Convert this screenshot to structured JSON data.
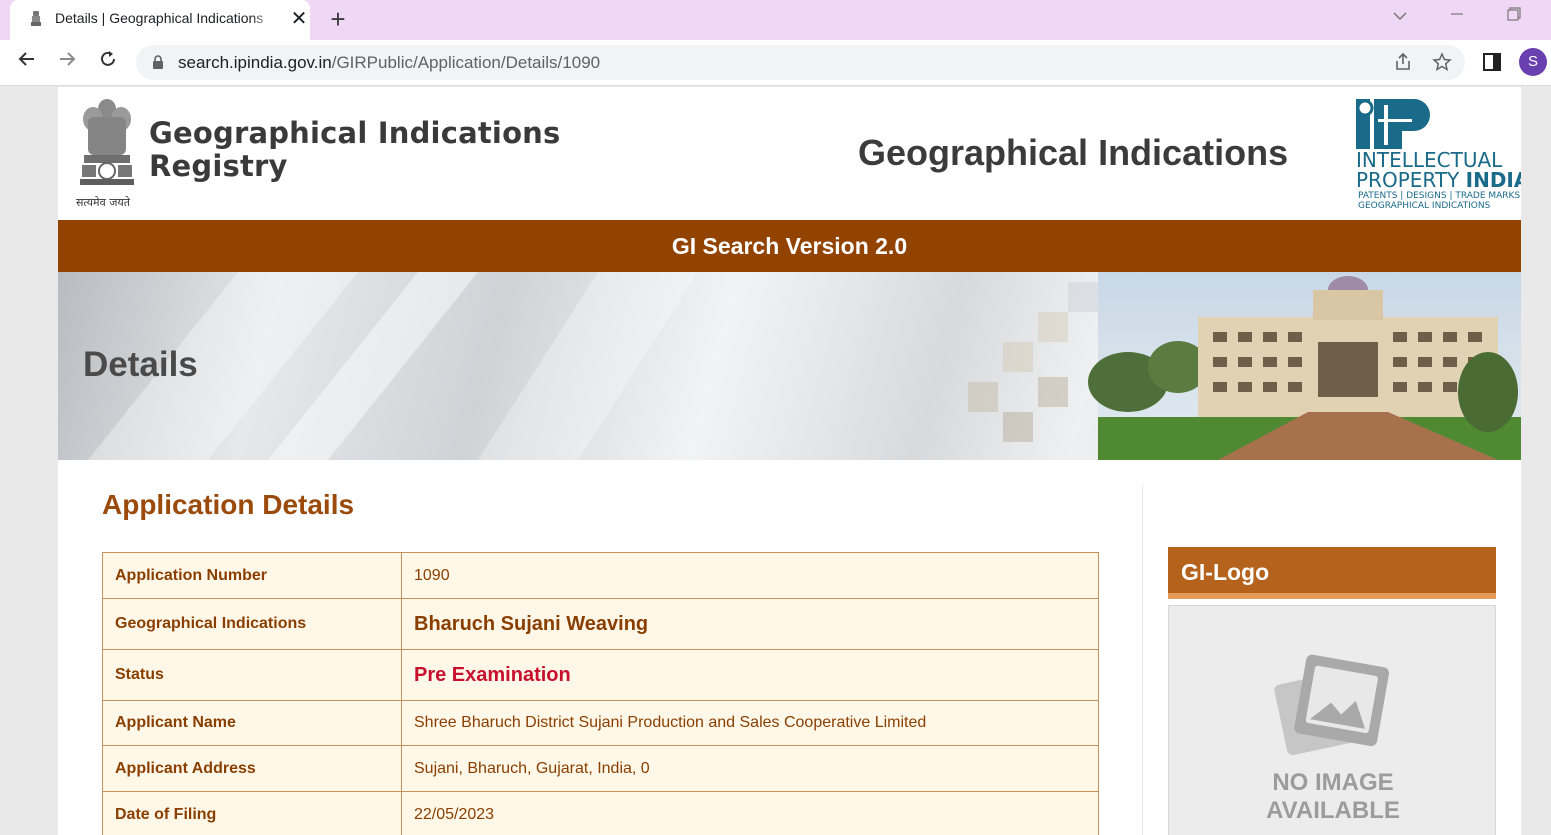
{
  "browser": {
    "tab_title": "Details | Geographical Indications",
    "new_tab_glyph": "+",
    "url_host": "search.ipindia.gov.in",
    "url_path": "/GIRPublic/Application/Details/1090",
    "profile_initial": "S"
  },
  "header": {
    "registry_line1": "Geographical Indications",
    "registry_line2": "Registry",
    "emblem_motto": "सत्यमेव जयते",
    "main_heading": "Geographical Indications",
    "ipi_line1": "INTELLECTUAL",
    "ipi_line2a": "PROPERTY ",
    "ipi_line2b": "INDIA",
    "ipi_line3": "PATENTS | DESIGNS | TRADE MARKS",
    "ipi_line4": "GEOGRAPHICAL INDICATIONS"
  },
  "version_bar": "GI Search Version 2.0",
  "banner": {
    "title": "Details"
  },
  "application": {
    "title": "Application Details",
    "rows": [
      {
        "key": "Application Number",
        "value": "1090"
      },
      {
        "key": "Geographical Indications",
        "value": "Bharuch Sujani Weaving"
      },
      {
        "key": "Status",
        "value": "Pre Examination"
      },
      {
        "key": "Applicant Name",
        "value": "Shree Bharuch District Sujani Production and Sales Cooperative Limited"
      },
      {
        "key": "Applicant Address",
        "value": "Sujani, Bharuch, Gujarat, India, 0"
      },
      {
        "key": "Date of Filing",
        "value": "22/05/2023"
      }
    ]
  },
  "gi_logo": {
    "heading": "GI-Logo",
    "no_image_line1": "NO IMAGE",
    "no_image_line2": "AVAILABLE"
  },
  "colors": {
    "brand_brown": "#924300",
    "heading_brown": "#9b4a0b",
    "status_red": "#c8102e",
    "table_bg": "#fff8e8",
    "table_border": "#c9925c"
  },
  "icons": {
    "back": "arrow-left-icon",
    "forward": "arrow-right-icon",
    "reload": "reload-icon",
    "lock": "lock-icon",
    "share": "share-icon",
    "bookmark": "star-icon",
    "sidepanel": "side-panel-icon"
  }
}
